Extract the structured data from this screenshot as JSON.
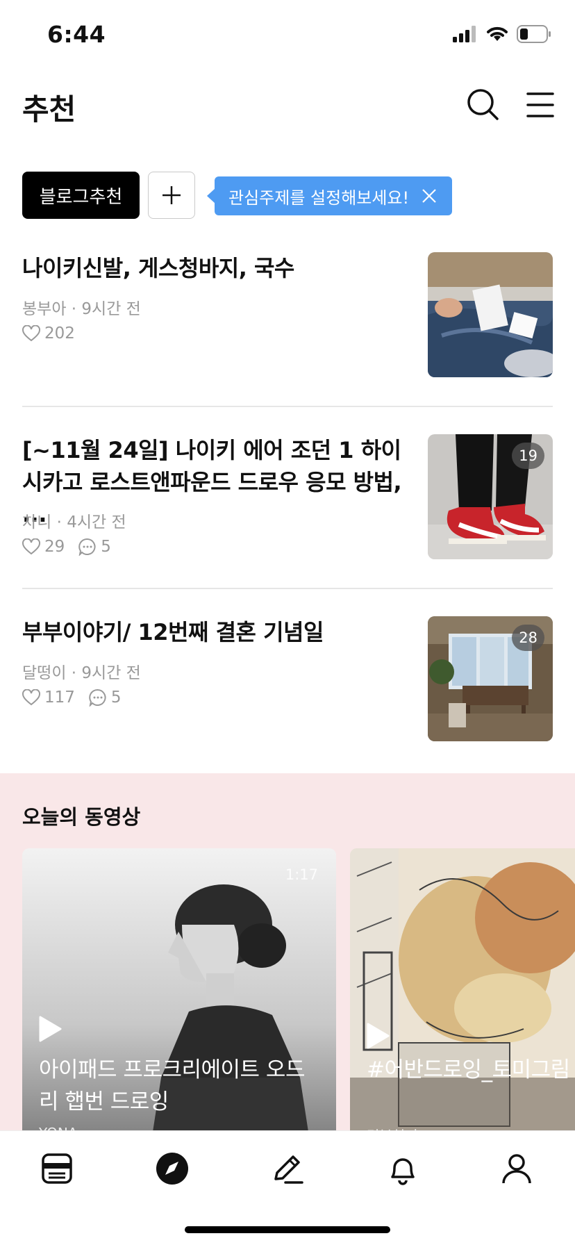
{
  "status_bar": {
    "time": "6:44"
  },
  "header": {
    "title": "추천"
  },
  "chips": {
    "active_label": "블로그추천",
    "tooltip_text": "관심주제를 설정해보세요!"
  },
  "feed": [
    {
      "title": "나이키신발, 게스청바지, 국수",
      "author": "봉부아",
      "time": "9시간 전",
      "likes": "202",
      "comments": null,
      "image_count": null,
      "thumbnail": "jeans-photo"
    },
    {
      "title": "[~11월 24일] 나이키 에어 조던 1 하이 시카고 로스트앤파운드 드로우 응모 방법, ...",
      "author": "차니",
      "time": "4시간 전",
      "likes": "29",
      "comments": "5",
      "image_count": "19",
      "thumbnail": "sneakers-photo"
    },
    {
      "title": "부부이야기/ 12번째 결혼 기념일",
      "author": "달떵이",
      "time": "9시간 전",
      "likes": "117",
      "comments": "5",
      "image_count": "28",
      "thumbnail": "dining-room-photo"
    }
  ],
  "videos": {
    "section_title": "오늘의 동영상",
    "items": [
      {
        "title": "아이패드 프로크리에이트 오드리 햅번 드로잉",
        "author": "YONA",
        "duration": "1:17"
      },
      {
        "title": "#어반드로잉_토미그림",
        "author": "멍붕허키",
        "duration": ""
      }
    ]
  },
  "tab_bar": [
    "feed-icon",
    "compass-icon",
    "pencil-icon",
    "bell-icon",
    "person-icon"
  ],
  "colors": {
    "tooltip": "#4e9bf2",
    "video_bg": "#f9e7e8",
    "chip_active": "#000000"
  }
}
